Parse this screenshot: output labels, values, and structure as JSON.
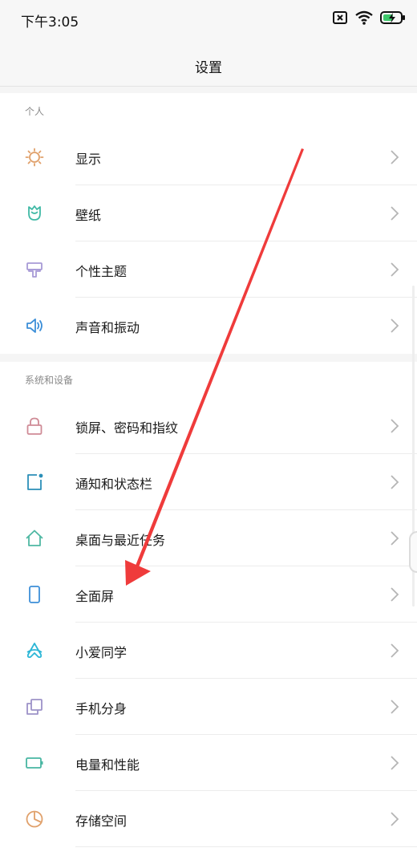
{
  "status_bar": {
    "time": "下午3:05",
    "icons": [
      "sim-off-icon",
      "wifi-icon",
      "battery-charging-icon"
    ]
  },
  "header": {
    "title": "设置"
  },
  "sections": [
    {
      "header": "个人",
      "items": [
        {
          "label": "显示",
          "icon": "sun-icon",
          "color": "#e0a06a"
        },
        {
          "label": "壁纸",
          "icon": "tulip-icon",
          "color": "#3fb9a5"
        },
        {
          "label": "个性主题",
          "icon": "paint-brush-icon",
          "color": "#a79ad6"
        },
        {
          "label": "声音和振动",
          "icon": "speaker-icon",
          "color": "#3d8fd8"
        }
      ]
    },
    {
      "header": "系统和设备",
      "items": [
        {
          "label": "锁屏、密码和指纹",
          "icon": "lock-icon",
          "color": "#cf8b96"
        },
        {
          "label": "通知和状态栏",
          "icon": "notification-icon",
          "color": "#2b8fb8"
        },
        {
          "label": "桌面与最近任务",
          "icon": "home-icon",
          "color": "#4fb8a3"
        },
        {
          "label": "全面屏",
          "icon": "phone-icon",
          "color": "#3d8fd8"
        },
        {
          "label": "小爱同学",
          "icon": "xiaoai-icon",
          "color": "#2bb6d6"
        },
        {
          "label": "手机分身",
          "icon": "clone-icon",
          "color": "#9d92c8"
        },
        {
          "label": "电量和性能",
          "icon": "battery-icon",
          "color": "#48b6a2"
        },
        {
          "label": "存储空间",
          "icon": "pie-chart-icon",
          "color": "#e0a06a"
        }
      ]
    }
  ],
  "annotation": {
    "arrow_color": "#ef3b3b"
  }
}
